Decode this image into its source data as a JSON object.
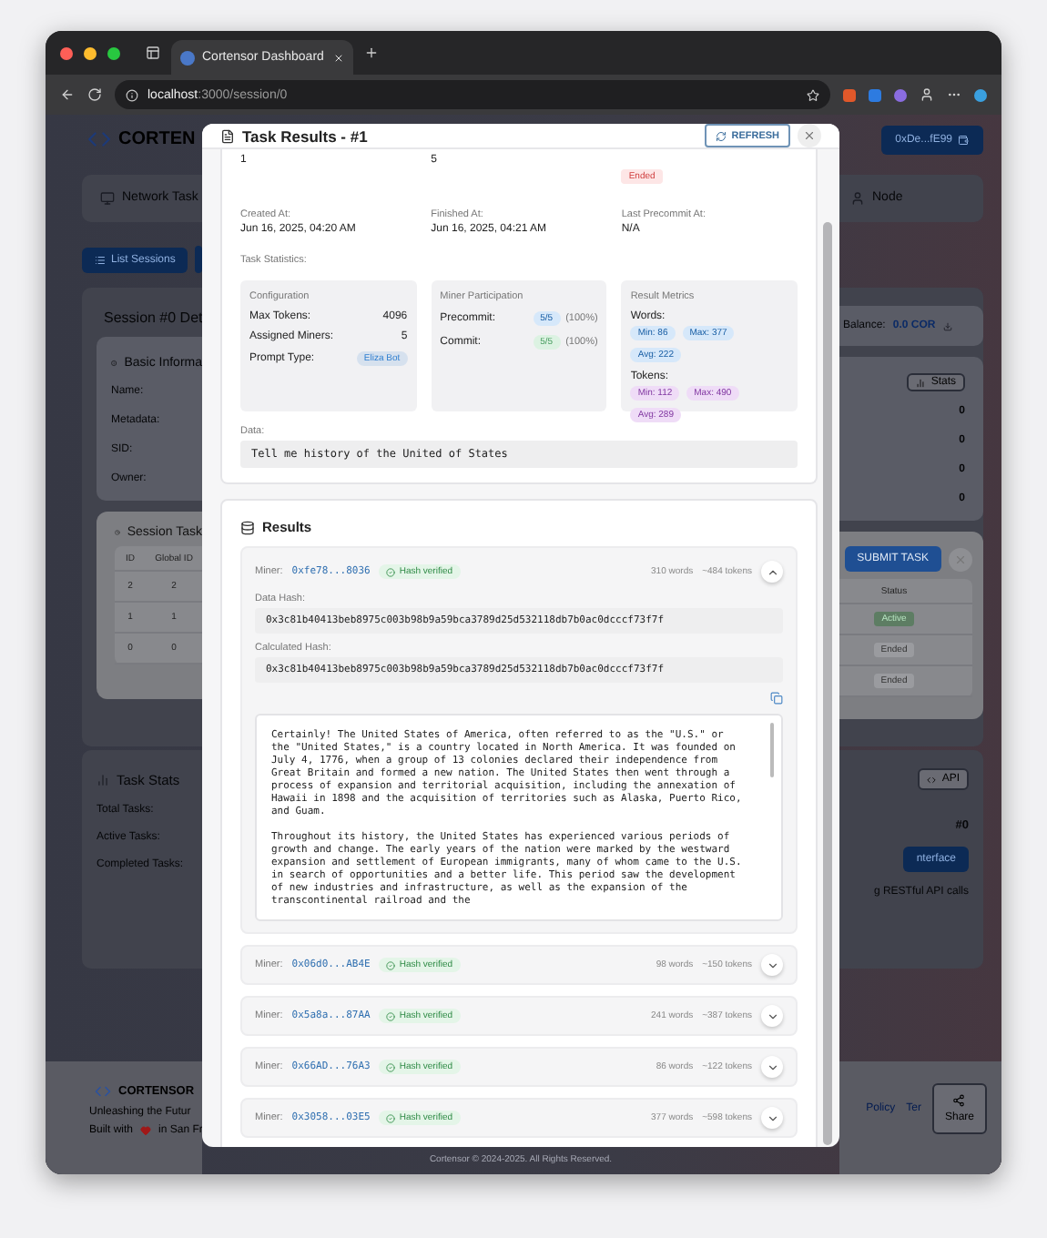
{
  "browser": {
    "tab_title": "Cortensor Dashboard",
    "url_host": "localhost",
    "url_path": ":3000/session/0"
  },
  "page": {
    "logo": "CORTEN",
    "wallet": "0xDe...fE99",
    "nav_left": "Network Task",
    "nav_right": "Node",
    "list_sessions": "List Sessions",
    "session_title": "Session #0 Det",
    "balance_label": "Balance:",
    "balance_value": "0.0 COR",
    "basic_info": {
      "title": "Basic Informa",
      "button": "Stats",
      "fields": [
        {
          "label": "Name:",
          "value": "0"
        },
        {
          "label": "Metadata:",
          "value": "0"
        },
        {
          "label": "SID:",
          "value": "0"
        },
        {
          "label": "Owner:",
          "value": "0"
        }
      ]
    },
    "session_tasks": {
      "title": "Session Task",
      "submit": "SUBMIT TASK",
      "columns": [
        "ID",
        "Global ID",
        "Status"
      ],
      "rows": [
        {
          "id": "2",
          "global_id": "2",
          "status": "Active",
          "kind": "active"
        },
        {
          "id": "1",
          "global_id": "1",
          "status": "Ended",
          "kind": "ended"
        },
        {
          "id": "0",
          "global_id": "0",
          "status": "Ended",
          "kind": "ended"
        }
      ]
    },
    "task_stats": {
      "title": "Task Stats",
      "api_button": "API",
      "fields": [
        "Total Tasks:",
        "Active Tasks:",
        "Completed Tasks:"
      ],
      "value": "#0",
      "interface_button": "nterface",
      "note": "g RESTful API calls"
    },
    "footer": {
      "logo": "CORTENSOR",
      "tagline": "Unleashing the Futur",
      "built_before": "Built with",
      "built_after": "in San Fr",
      "links": [
        "Policy",
        "Ter"
      ],
      "share": "Share",
      "copyright": "Cortensor © 2024-2025. All Rights Reserved."
    }
  },
  "modal": {
    "title": "Task Results - #1",
    "refresh": "REFRESH",
    "summary": {
      "values": [
        "1",
        "5"
      ],
      "status": "Ended",
      "kind": "ended"
    },
    "times": [
      {
        "label": "Created At:",
        "value": "Jun 16, 2025, 04:20 AM"
      },
      {
        "label": "Finished At:",
        "value": "Jun 16, 2025, 04:21 AM"
      },
      {
        "label": "Last Precommit At:",
        "value": "N/A"
      }
    ],
    "stats_label": "Task Statistics:",
    "configuration": {
      "title": "Configuration",
      "rows": [
        {
          "label": "Max Tokens:",
          "value": "4096",
          "kind": "plain"
        },
        {
          "label": "Assigned Miners:",
          "value": "5",
          "kind": "plain"
        },
        {
          "label": "Prompt Type:",
          "value": "Eliza Bot",
          "kind": "badge"
        }
      ]
    },
    "participation": {
      "title": "Miner Participation",
      "rows": [
        {
          "label": "Precommit:",
          "value": "5/5",
          "percent": "(100%)",
          "color": "#d6e8fa"
        },
        {
          "label": "Commit:",
          "value": "5/5",
          "percent": "(100%)",
          "color": "#dcf2e2"
        }
      ]
    },
    "metrics": {
      "title": "Result Metrics",
      "groups": [
        {
          "label": "Words:",
          "color": "#d6e8fa",
          "values": [
            "Min: 86",
            "Max: 377",
            "Avg: 222"
          ]
        },
        {
          "label": "Tokens:",
          "color": "#efdcf7",
          "values": [
            "Min: 112",
            "Max: 490",
            "Avg: 289"
          ]
        }
      ]
    },
    "data_label": "Data:",
    "data": "Tell me history of the United of States",
    "results": {
      "title": "Results",
      "miners": [
        {
          "label": "Miner:",
          "address": "0xfe78...8036",
          "verified": true,
          "verified_text": "Hash verified",
          "words": "310 words",
          "tokens": "~484 tokens",
          "expanded": true,
          "data_hash_label": "Data Hash:",
          "data_hash": "0x3c81b40413beb8975c003b98b9a59bca3789d25d532118db7b0ac0dcccf73f7f",
          "calc_hash_label": "Calculated Hash:",
          "calc_hash": "0x3c81b40413beb8975c003b98b9a59bca3789d25d532118db7b0ac0dcccf73f7f",
          "output": [
            "Certainly! The United States of America, often referred to as the \"U.S.\" or the \"United States,\" is a country located in North America. It was founded on July 4, 1776, when a group of 13 colonies declared their independence from Great Britain and formed a new nation. The United States then went through a process of expansion and territorial acquisition, including the annexation of Hawaii in 1898 and the acquisition of territories such as Alaska, Puerto Rico, and Guam.",
            "Throughout its history, the United States has experienced various periods of growth and change. The early years of the nation were marked by the westward expansion and settlement of European immigrants, many of whom came to the U.S. in search of opportunities and a better life. This period saw the development of new industries and infrastructure, as well as the expansion of the transcontinental railroad and the"
          ]
        },
        {
          "label": "Miner:",
          "address": "0x06d0...AB4E",
          "verified": true,
          "verified_text": "Hash verified",
          "words": "98 words",
          "tokens": "~150 tokens",
          "expanded": false
        },
        {
          "label": "Miner:",
          "address": "0x5a8a...87AA",
          "verified": true,
          "verified_text": "Hash verified",
          "words": "241 words",
          "tokens": "~387 tokens",
          "expanded": false
        },
        {
          "label": "Miner:",
          "address": "0x66AD...76A3",
          "verified": true,
          "verified_text": "Hash verified",
          "words": "86 words",
          "tokens": "~122 tokens",
          "expanded": false
        },
        {
          "label": "Miner:",
          "address": "0x3058...03E5",
          "verified": true,
          "verified_text": "Hash verified",
          "words": "377 words",
          "tokens": "~598 tokens",
          "expanded": false
        }
      ]
    }
  }
}
